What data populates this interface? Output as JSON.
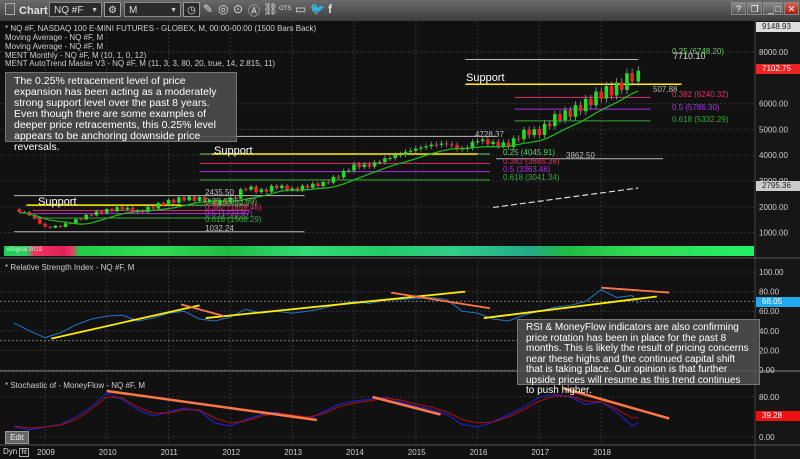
{
  "window": {
    "title": "Chart",
    "symbol": "NQ #F",
    "interval": "M",
    "buttons": [
      "help",
      "restore",
      "minimize",
      "maximize",
      "close"
    ],
    "icons": [
      "symbol-settings-icon",
      "clock-icon",
      "pencil-icon",
      "refresh-icon",
      "play-icon",
      "alert-icon",
      "link-icon",
      "ots-icon",
      "comment-icon",
      "twitter-icon",
      "facebook-icon"
    ]
  },
  "main_panel": {
    "legend": [
      "* NQ #F, NASDAQ 100 E-MINI FUTURES - GLOBEX, M, 00:00-00:00 (1500 Bars Back)",
      "Moving Average - NQ #F, M",
      "Moving Average - NQ #F, M",
      "MENT Monthly - NQ #F, M (10, 1, 0, 12)",
      "MENT AutoTrend Master V3 - NQ #F, M (11, 3, 3, 80, 20, true, 14, 2.815, 11)"
    ],
    "note": "The 0.25% retracement level of price expansion has been acting as a moderately strong support level over the past 8 years.  Even though there are some examples of deeper price retracements, this 0.25% level appears to be anchoring downside price reversals.",
    "signal_label": "eSignal 2019",
    "support_label": "Support",
    "fib_sets": [
      {
        "high_label": "2435.50",
        "low_label": "1032.24",
        "levels": [
          "0.25 (2063.69)",
          "0.382 (1859.46)",
          "0.5 (1733.87)",
          "0.618 (1568.29)"
        ]
      },
      {
        "high_label": "4728.37",
        "low_label": "3862.50",
        "levels": [
          "0.25 (4045.91)",
          "0.382 (3685.38)",
          "0.5 (3363.46)",
          "0.618 (3041.34)"
        ]
      },
      {
        "high_label": "7710.10",
        "range_label": "507.88",
        "levels": [
          "0.25 (6748.20)",
          "0.382 (6240.32)",
          "0.5 (5786.30)",
          "0.618 (5332.29)"
        ]
      }
    ],
    "last_price": "7102.75",
    "top_value": "9148.93",
    "ma_value": "2795.36"
  },
  "rsi_panel": {
    "title": "* Relative Strength Index - NQ #F, M",
    "last_value": "68.05",
    "note": "RSI & MoneyFlow indicators are also confirming price rotation has been in place for the past 8 months. This is likely the result of pricing concerns near these highs and the continued capital shift that is taking place. Our opinion is that further upside prices will resume as this trend continues to push higher."
  },
  "stoch_panel": {
    "title": "* Stochastic of - MoneyFlow - NQ #F, M",
    "last_value": "39.28",
    "edit_label": "Edit",
    "dyn_label": "Dyn"
  },
  "colors": {
    "up": "#22dd22",
    "down": "#ee2222",
    "support": "#ffee00",
    "trend": "#ff7744",
    "rsi": "#2277cc",
    "stoch_k": "#2222dd",
    "stoch_d": "#aa1111",
    "last_price": "#ee2222",
    "rsi_badge": "#22aaee"
  },
  "chart_data": {
    "type": "candlestick",
    "x_ticks": [
      "2009",
      "2010",
      "2011",
      "2012",
      "2013",
      "2014",
      "2015",
      "2016",
      "2017",
      "2018"
    ],
    "price_ticks": [
      "8000.00",
      "6000.00",
      "5000.00",
      "4000.00",
      "3000.00",
      "2000.00",
      "1000.00"
    ],
    "rsi_ticks": [
      "100.00",
      "80.00",
      "60.00",
      "40.00",
      "20.00",
      "0.00"
    ],
    "stoch_ticks": [
      "80.00",
      "0.00"
    ],
    "quarters": [
      2008.5,
      2008.75,
      2009,
      2009.25,
      2009.5,
      2009.75,
      2010,
      2010.25,
      2010.5,
      2010.75,
      2011,
      2011.25,
      2011.5,
      2011.75,
      2012,
      2012.25,
      2012.5,
      2012.75,
      2013,
      2013.25,
      2013.5,
      2013.75,
      2014,
      2014.25,
      2014.5,
      2014.75,
      2015,
      2015.25,
      2015.5,
      2015.75,
      2016,
      2016.25,
      2016.5,
      2016.75,
      2017,
      2017.25,
      2017.5,
      2017.75,
      2018,
      2018.25,
      2018.5,
      2018.6
    ],
    "close": [
      1900,
      1700,
      1200,
      1250,
      1480,
      1720,
      1860,
      1960,
      1800,
      2000,
      2200,
      2330,
      2300,
      2150,
      2280,
      2750,
      2600,
      2800,
      2650,
      2800,
      2900,
      3200,
      3590,
      3600,
      3850,
      4050,
      4250,
      4400,
      4450,
      4200,
      4600,
      4450,
      4400,
      4880,
      4900,
      5450,
      5650,
      6000,
      6400,
      6600,
      7100,
      7102.75
    ],
    "fib_lines": [
      {
        "from": 2008.5,
        "to": 2013.2,
        "value": 2435.5,
        "color": "#bbbbbb"
      },
      {
        "from": 2008.5,
        "to": 2013.2,
        "value": 1032.24,
        "color": "#bbbbbb"
      },
      {
        "from": 2008.8,
        "to": 2012.3,
        "value": 2063.69,
        "color": "#66cc66"
      },
      {
        "from": 2008.8,
        "to": 2012.3,
        "value": 1859.46,
        "color": "#dd3366"
      },
      {
        "from": 2008.8,
        "to": 2012.3,
        "value": 1733.87,
        "color": "#aa33dd"
      },
      {
        "from": 2008.8,
        "to": 2012.3,
        "value": 1568.29,
        "color": "#33aa33"
      },
      {
        "from": 2011.5,
        "to": 2016.3,
        "value": 4728.37,
        "color": "#bbbbbb"
      },
      {
        "from": 2016.3,
        "to": 2019.0,
        "value": 3862.5,
        "color": "#bbbbbb"
      },
      {
        "from": 2011.5,
        "to": 2016.2,
        "value": 4045.91,
        "color": "#66cc66"
      },
      {
        "from": 2011.5,
        "to": 2016.2,
        "value": 3685.38,
        "color": "#dd3366"
      },
      {
        "from": 2011.5,
        "to": 2016.2,
        "value": 3363.46,
        "color": "#aa33dd"
      },
      {
        "from": 2011.5,
        "to": 2016.2,
        "value": 3041.34,
        "color": "#33aa33"
      },
      {
        "from": 2015.8,
        "to": 2018.6,
        "value": 7710.1,
        "color": "#bbbbbb"
      },
      {
        "from": 2016.6,
        "to": 2018.8,
        "value": 6240.32,
        "color": "#dd3366"
      },
      {
        "from": 2016.6,
        "to": 2018.8,
        "value": 5786.3,
        "color": "#aa33dd"
      },
      {
        "from": 2016.6,
        "to": 2018.8,
        "value": 5332.29,
        "color": "#33aa33"
      }
    ],
    "support_lines": [
      {
        "from": 2008.7,
        "to": 2011.2,
        "value": 2063.69
      },
      {
        "from": 2011.7,
        "to": 2016.0,
        "value": 4045.91
      },
      {
        "from": 2015.8,
        "to": 2019.3,
        "value": 6748.2
      }
    ],
    "rsi": [
      48,
      40,
      33,
      38,
      46,
      52,
      55,
      56,
      50,
      53,
      58,
      60,
      52,
      50,
      54,
      62,
      58,
      60,
      58,
      60,
      63,
      67,
      70,
      68,
      71,
      72,
      73,
      74,
      72,
      60,
      58,
      52,
      50,
      56,
      60,
      64,
      66,
      70,
      82,
      74,
      76,
      68
    ],
    "stoch_k": [
      20,
      14,
      20,
      25,
      40,
      60,
      88,
      75,
      55,
      42,
      50,
      58,
      52,
      28,
      22,
      35,
      45,
      50,
      40,
      35,
      50,
      65,
      72,
      75,
      80,
      70,
      62,
      55,
      45,
      25,
      20,
      30,
      45,
      60,
      80,
      85,
      80,
      65,
      70,
      50,
      22,
      28
    ],
    "stoch_d": [
      22,
      18,
      20,
      24,
      35,
      55,
      80,
      78,
      60,
      48,
      48,
      55,
      54,
      38,
      28,
      32,
      42,
      48,
      44,
      40,
      46,
      60,
      68,
      72,
      78,
      74,
      66,
      60,
      50,
      35,
      28,
      30,
      40,
      55,
      72,
      82,
      82,
      72,
      70,
      56,
      38,
      39
    ],
    "rsi_trendlines": [
      {
        "color": "#ffee00",
        "p": [
          [
            2009.1,
            32
          ],
          [
            2011.5,
            66
          ]
        ]
      },
      {
        "color": "#ffee00",
        "p": [
          [
            2011.6,
            53
          ],
          [
            2015.8,
            80
          ]
        ]
      },
      {
        "color": "#ffee00",
        "p": [
          [
            2016.1,
            53
          ],
          [
            2018.9,
            75
          ]
        ]
      },
      {
        "color": "#ff7744",
        "p": [
          [
            2011.2,
            67
          ],
          [
            2011.9,
            55
          ]
        ]
      },
      {
        "color": "#ff7744",
        "p": [
          [
            2014.6,
            79
          ],
          [
            2016.2,
            63
          ]
        ]
      },
      {
        "color": "#ff7744",
        "p": [
          [
            2018.0,
            84
          ],
          [
            2019.1,
            79
          ]
        ]
      }
    ],
    "stoch_trendlines": [
      {
        "color": "#ff7744",
        "p": [
          [
            2010.0,
            92
          ],
          [
            2013.4,
            34
          ]
        ]
      },
      {
        "color": "#ff7744",
        "p": [
          [
            2014.3,
            80
          ],
          [
            2015.4,
            45
          ]
        ]
      },
      {
        "color": "#ff7744",
        "p": [
          [
            2017.4,
            97
          ],
          [
            2019.1,
            37
          ]
        ]
      }
    ]
  }
}
